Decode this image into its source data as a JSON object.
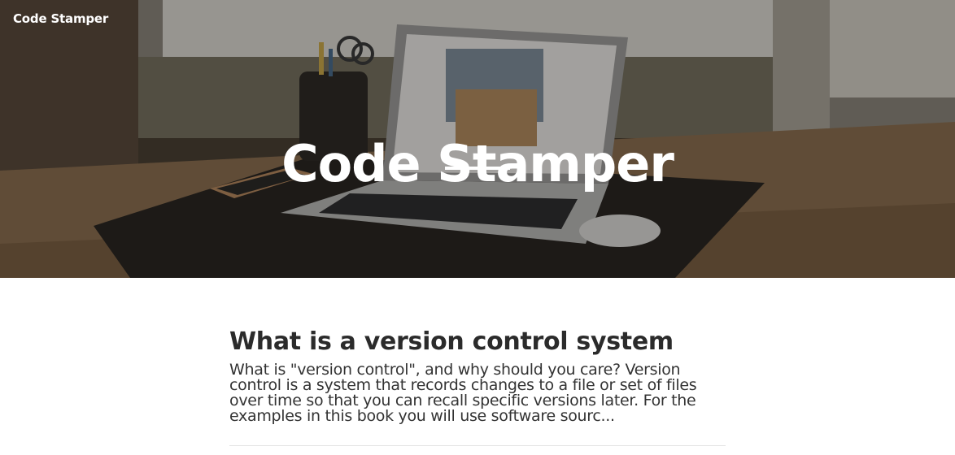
{
  "navbar": {
    "brand": "Code Stamper"
  },
  "hero": {
    "title": "Code Stamper",
    "background_image": "desk-laptop-photo",
    "overlay_color": "#000000"
  },
  "post": {
    "title": "What is a version control system",
    "excerpt": "What is \"version control\", and why should you care? Version control is a system that records changes to a file or set of files over time so that you can recall specific versions later. For the examples in this book you will use software sourc..."
  },
  "colors": {
    "heading": "#2b2b2b",
    "text": "#333333",
    "separator": "#e4e4e4"
  }
}
